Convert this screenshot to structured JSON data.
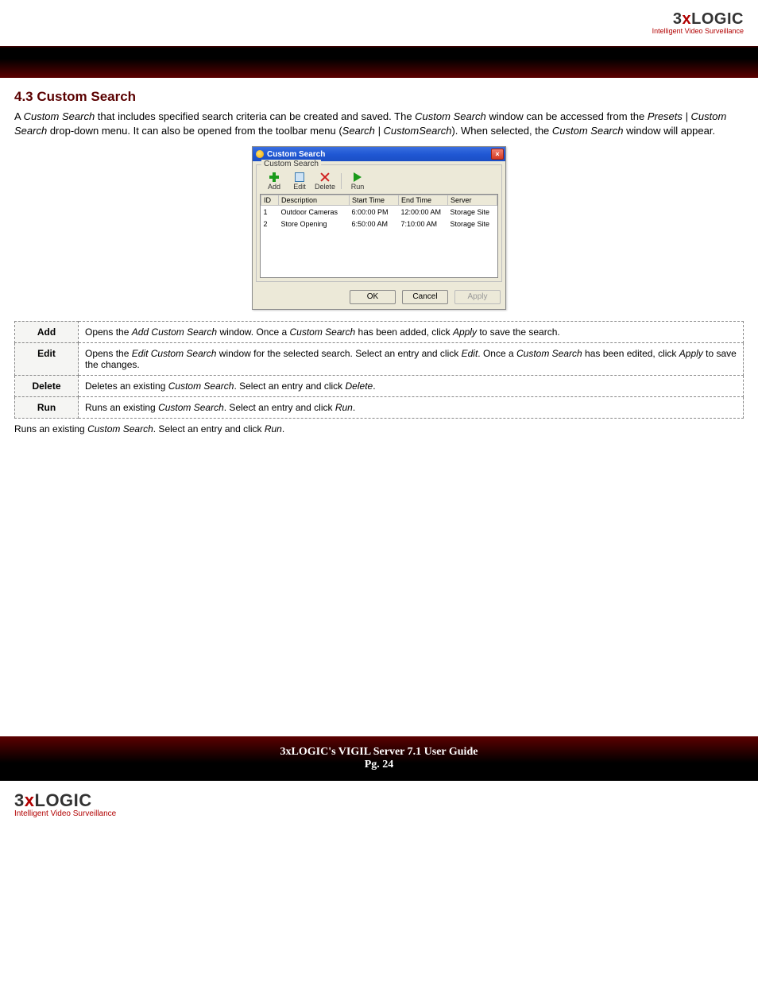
{
  "brand": {
    "main_parts": {
      "three": "3",
      "x": "x",
      "rest": "LOGIC"
    },
    "tagline": "Intelligent Video Surveillance"
  },
  "section": {
    "heading": "4.3 Custom Search",
    "intro_parts": {
      "t1": "A ",
      "i1": "Custom Search",
      "t2": " that includes specified search criteria can be created and saved. The ",
      "i2": "Custom Search",
      "t3": " window can be accessed from the ",
      "i3": "Presets | Custom Search",
      "t4": " drop-down menu. It can also be opened from the toolbar menu (",
      "i4": "Search | CustomSearch",
      "t5": "). When selected, the ",
      "i5": "Custom Search",
      "t6": " window will appear."
    }
  },
  "cswin": {
    "title": "Custom Search",
    "group_label": "Custom Search",
    "toolbar": {
      "add": "Add",
      "edit": "Edit",
      "del": "Delete",
      "run": "Run"
    },
    "columns": {
      "id": "ID",
      "desc": "Description",
      "start": "Start Time",
      "end": "End Time",
      "server": "Server"
    },
    "rows": [
      {
        "id": "1",
        "desc": "Outdoor Cameras",
        "start": "6:00:00 PM",
        "end": "12:00:00 AM",
        "server": "Storage Site"
      },
      {
        "id": "2",
        "desc": "Store Opening",
        "start": "6:50:00 AM",
        "end": "7:10:00 AM",
        "server": "Storage Site"
      }
    ],
    "buttons": {
      "ok": "OK",
      "cancel": "Cancel",
      "apply": "Apply"
    }
  },
  "deftable": {
    "add": {
      "label": "Add",
      "parts": {
        "t1": "Opens the ",
        "i1": "Add Custom Search",
        "t2": " window. Once a ",
        "i2": "Custom Search",
        "t3": " has been added, click ",
        "i3": "Apply",
        "t4": " to save the search."
      }
    },
    "edit": {
      "label": "Edit",
      "parts": {
        "t1": "Opens the ",
        "i1": "Edit Custom Search",
        "t2": " window for the selected search. Select an entry and click ",
        "i2": "Edit",
        "t3": ". Once a ",
        "i3": "Custom Search",
        "t4": " has been edited, click ",
        "i4": "Apply",
        "t5": " to save the changes."
      }
    },
    "delete": {
      "label": "Delete",
      "parts": {
        "t1": "Deletes an existing ",
        "i1": "Custom Search",
        "t2": ". Select an entry and click ",
        "i2": "Delete",
        "t3": "."
      }
    },
    "run": {
      "label": "Run",
      "parts": {
        "t1": "Runs an existing ",
        "i1": "Custom Search",
        "t2": ". Select an entry and click ",
        "i2": "Run",
        "t3": "."
      }
    }
  },
  "below": {
    "parts": {
      "t1": "Runs an existing ",
      "i1": "Custom Search",
      "t2": ". Select an entry and click ",
      "i2": "Run",
      "t3": "."
    }
  },
  "footer": {
    "line1": "3xLOGIC's VIGIL Server 7.1 User Guide",
    "line2": "Pg. 24"
  }
}
